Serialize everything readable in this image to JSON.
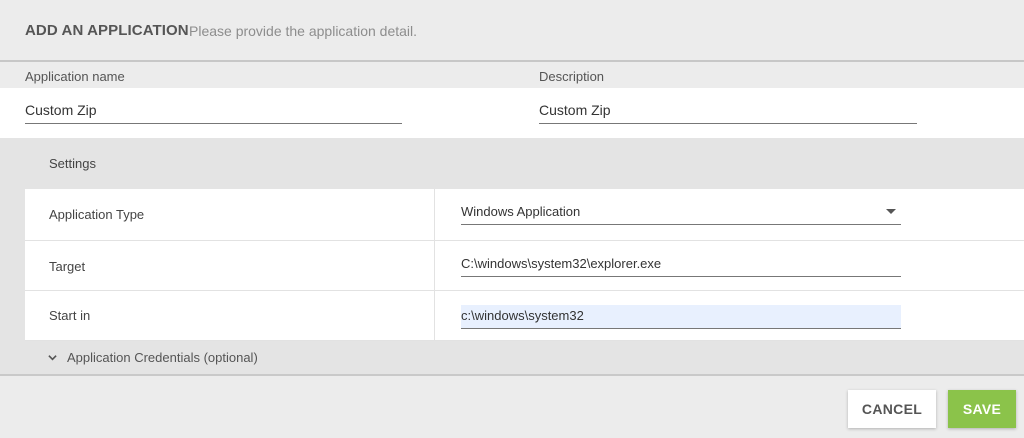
{
  "header": {
    "title": "ADD AN APPLICATION",
    "subtitle": "Please provide the application detail."
  },
  "fields": {
    "app_name_label": "Application name",
    "app_name_value": "Custom Zip",
    "description_label": "Description",
    "description_value": "Custom Zip"
  },
  "settings": {
    "title": "Settings",
    "rows": [
      {
        "label": "Application Type",
        "value": "Windows Application"
      },
      {
        "label": "Target",
        "value": "C:\\windows\\system32\\explorer.exe"
      },
      {
        "label": "Start in",
        "value": "c:\\windows\\system32"
      }
    ],
    "credentials_label": "Application Credentials (optional)"
  },
  "footer": {
    "cancel_label": "CANCEL",
    "save_label": "SAVE"
  },
  "colors": {
    "save_button": "#8bc34a",
    "highlight": "#e8f0fe"
  }
}
